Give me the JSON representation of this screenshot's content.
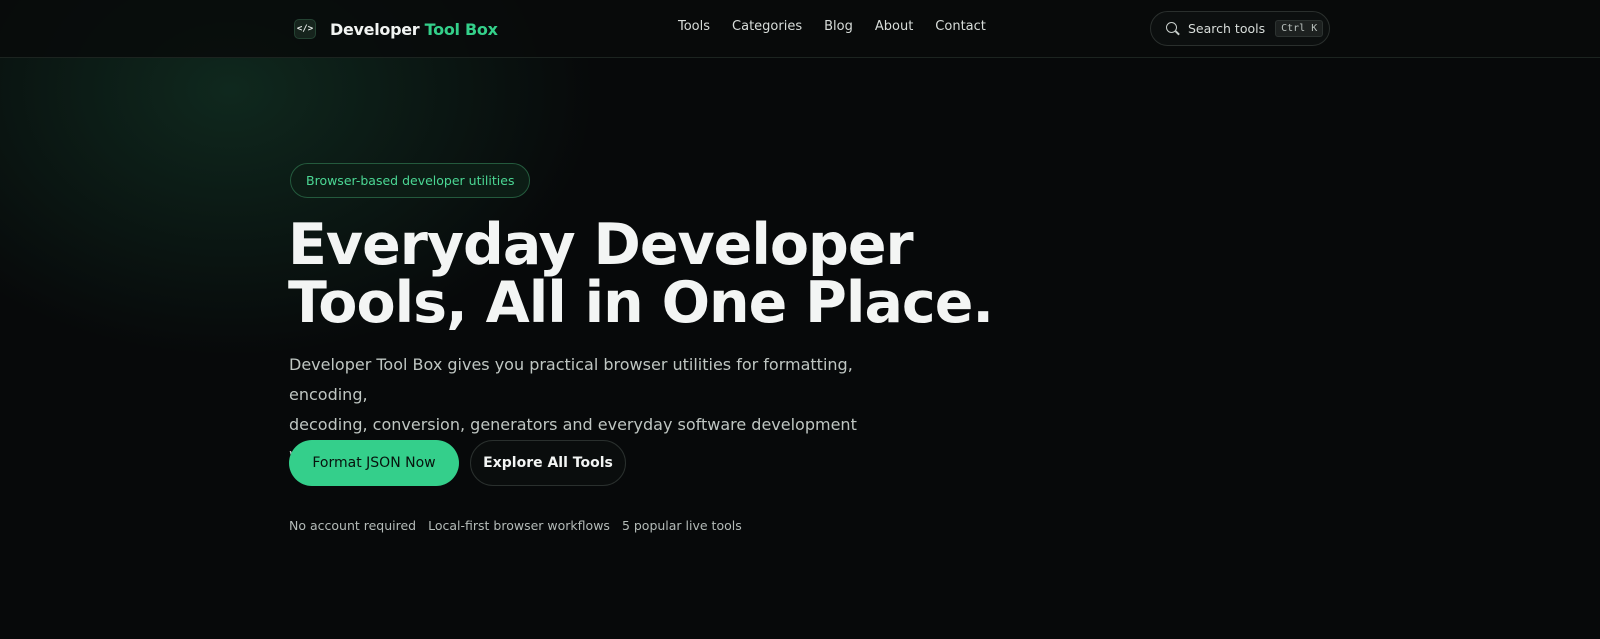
{
  "brand": {
    "name_part1": "Developer",
    "name_part2": "Tool Box",
    "icon": "code-brackets-icon"
  },
  "nav": {
    "links": [
      "Tools",
      "Categories",
      "Blog",
      "About",
      "Contact"
    ]
  },
  "search": {
    "label": "Search tools",
    "shortcut": "Ctrl K",
    "icon": "search-icon"
  },
  "hero": {
    "badge": "Browser-based developer utilities",
    "headline_line1": "Everyday Developer",
    "headline_line2": "Tools, All in One Place.",
    "subtext_line1": "Developer Tool Box gives you practical browser utilities for formatting, encoding,",
    "subtext_line2": "decoding, conversion, generators and everyday software development workflows.",
    "primary_button": "Format JSON Now",
    "secondary_button": "Explore All Tools",
    "features": [
      "No account required",
      "Local-first browser workflows",
      "5 popular live tools"
    ]
  },
  "colors": {
    "accent": "#34cf8b",
    "background": "#07090a",
    "text": "#f3f5f4"
  }
}
